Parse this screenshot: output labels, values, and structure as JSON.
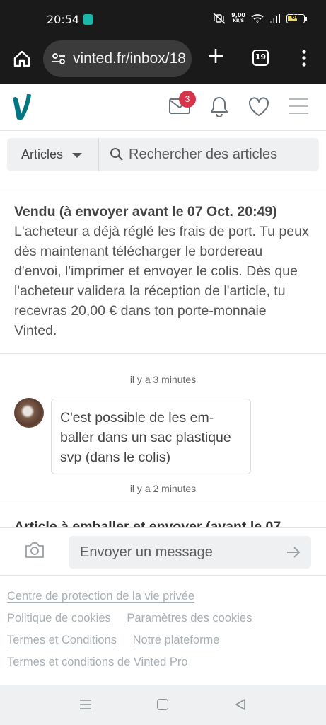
{
  "statusbar": {
    "time": "20:54",
    "net_speed_value": "9,00",
    "net_speed_unit": "KB/S",
    "battery": "60",
    "battery_level": 0.6
  },
  "browser": {
    "url": "vinted.fr/inbox/18",
    "tab_count": "19"
  },
  "header": {
    "inbox_badge": "3",
    "brand_color": "#007782",
    "badge_color": "#d6344b"
  },
  "search": {
    "category_label": "Articles",
    "placeholder": "Rechercher des articles"
  },
  "conversation": {
    "status_title": "Vendu (à envoyer avant le 07 Oct. 20:49)",
    "status_body": "L'acheteur a déjà réglé les frais de port. Tu peux dès maintenant télécharger le bordereau d'envoi, l'imprimer et envoyer le colis. Dès que l'acheteur validera la réception de l'article, tu recevras 20,00 € dans ton porte-monnaie Vinted.",
    "timestamp_1": "il y a 3 minutes",
    "message_text": "C'est possible de les em­baller dans un sac plas­tique svp (dans le colis)",
    "timestamp_2": "il y a 2 minutes",
    "next_status_partial": "Article à emballer et envoyer (avant le 07"
  },
  "composer": {
    "placeholder": "Envoyer un message"
  },
  "footer": {
    "privacy": "Centre de protection de la vie privée",
    "cookies_policy": "Politique de cookies",
    "cookies_settings": "Paramètres des cookies",
    "terms": "Termes et Conditions",
    "platform": "Notre plateforme",
    "pro_terms": "Termes et conditions de Vinted Pro"
  }
}
